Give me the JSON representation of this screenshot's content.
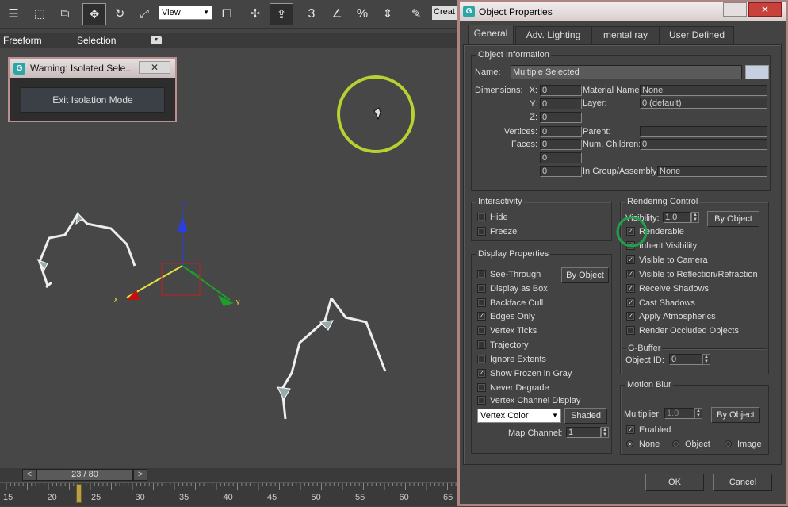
{
  "toolbar": {
    "view_select": "View",
    "spinner_snap": "3",
    "angle_snap_label": "%",
    "create_selection": "Creat"
  },
  "ribbon": {
    "freeform": "Freeform",
    "selection": "Selection"
  },
  "viewport": {
    "axis_x": "x",
    "axis_y": "y",
    "axis_z": "z"
  },
  "warning": {
    "title": "Warning: Isolated Sele...",
    "exit_button": "Exit Isolation Mode",
    "close": "✕"
  },
  "timeline": {
    "frame_display": "23 / 80",
    "prev": "<",
    "next": ">",
    "ticks": [
      "15",
      "20",
      "25",
      "30",
      "35",
      "40",
      "45",
      "50",
      "55",
      "60",
      "65"
    ]
  },
  "dialog": {
    "title": "Object Properties",
    "close": "✕",
    "tabs": [
      "General",
      "Adv. Lighting",
      "mental ray",
      "User Defined"
    ],
    "object_info": {
      "group": "Object Information",
      "name_label": "Name:",
      "name_value": "Multiple Selected",
      "dimensions_label": "Dimensions:",
      "x_label": "X:",
      "y_label": "Y:",
      "z_label": "Z:",
      "x": "0",
      "y": "0",
      "z": "0",
      "vertices_label": "Vertices:",
      "vertices": "0",
      "faces_label": "Faces:",
      "faces": "0",
      "extra1": "0",
      "extra2": "0",
      "material_label": "Material Name:",
      "material": "None",
      "layer_label": "Layer:",
      "layer": "0 (default)",
      "parent_label": "Parent:",
      "parent": "",
      "children_label": "Num. Children:",
      "children": "0",
      "group_label": "In Group/Assembly:",
      "group_value": "None"
    },
    "interactivity": {
      "group": "Interactivity",
      "hide": "Hide",
      "freeze": "Freeze"
    },
    "display": {
      "group": "Display Properties",
      "by_object": "By Object",
      "items": [
        {
          "label": "See-Through",
          "checked": false
        },
        {
          "label": "Display as Box",
          "checked": false
        },
        {
          "label": "Backface Cull",
          "checked": false
        },
        {
          "label": "Edges Only",
          "checked": true
        },
        {
          "label": "Vertex Ticks",
          "checked": false
        },
        {
          "label": "Trajectory",
          "checked": false
        },
        {
          "label": "Ignore Extents",
          "checked": false
        },
        {
          "label": "Show Frozen in Gray",
          "checked": true
        },
        {
          "label": "Never Degrade",
          "checked": false
        },
        {
          "label": "Vertex Channel Display",
          "checked": false
        }
      ],
      "vertex_color": "Vertex Color",
      "shaded": "Shaded",
      "map_channel_label": "Map Channel:",
      "map_channel": "1"
    },
    "rendering": {
      "group": "Rendering Control",
      "visibility_label": "Visibility:",
      "visibility": "1.0",
      "by_object": "By Object",
      "items": [
        {
          "label": "Renderable",
          "checked": true
        },
        {
          "label": "Inherit Visibility",
          "checked": true
        },
        {
          "label": "Visible to Camera",
          "checked": true
        },
        {
          "label": "Visible to Reflection/Refraction",
          "checked": true
        },
        {
          "label": "Receive Shadows",
          "checked": true
        },
        {
          "label": "Cast Shadows",
          "checked": true
        },
        {
          "label": "Apply Atmospherics",
          "checked": true
        },
        {
          "label": "Render Occluded Objects",
          "checked": false
        }
      ]
    },
    "gbuffer": {
      "group": "G-Buffer",
      "object_id_label": "Object ID:",
      "object_id": "0"
    },
    "motion_blur": {
      "group": "Motion Blur",
      "multiplier_label": "Multiplier:",
      "multiplier": "1.0",
      "by_object": "By Object",
      "enabled_label": "Enabled",
      "enabled": true,
      "none": "None",
      "object": "Object",
      "image": "Image"
    },
    "ok": "OK",
    "cancel": "Cancel"
  },
  "colors": {
    "selection_ring": "#b5d330",
    "highlight_ring": "#1fa34a",
    "dialog_border": "#b18282"
  }
}
